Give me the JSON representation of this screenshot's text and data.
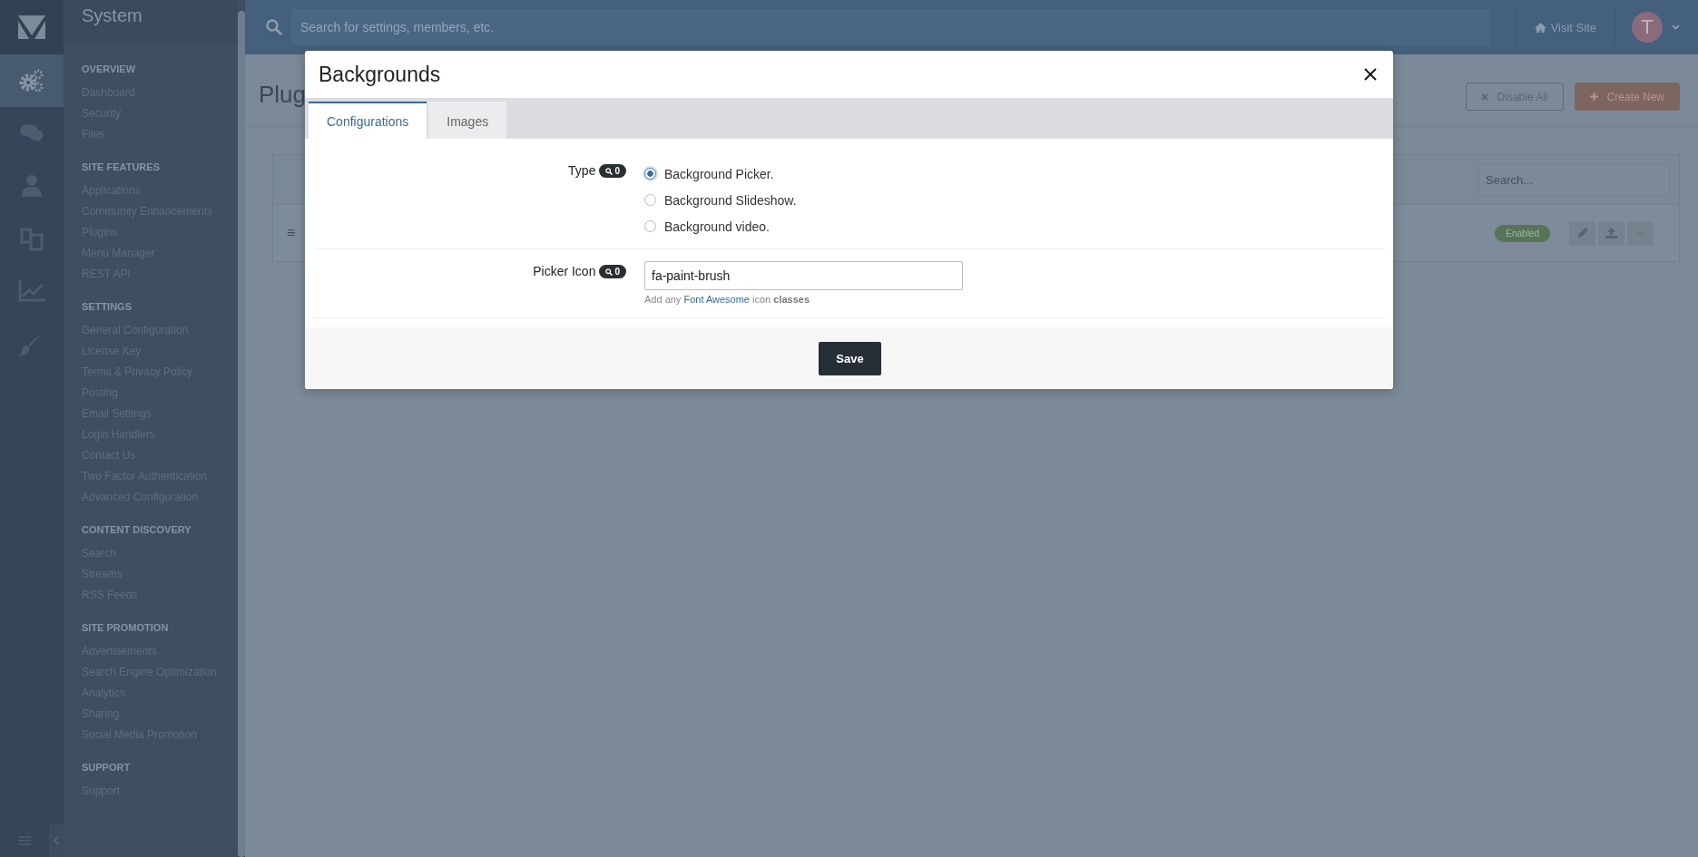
{
  "rail": [
    {
      "selected": true
    },
    {
      "selected": false
    },
    {
      "selected": false
    },
    {
      "selected": false
    },
    {
      "selected": false
    },
    {
      "selected": false
    }
  ],
  "sidebar": {
    "title": "System",
    "sections": [
      {
        "heading": "OVERVIEW",
        "items": [
          "Dashboard",
          "Security",
          "Files"
        ]
      },
      {
        "heading": "SITE FEATURES",
        "items": [
          "Applications",
          "Community Enhancements",
          "Plugins",
          "Menu Manager",
          "REST API"
        ]
      },
      {
        "heading": "SETTINGS",
        "items": [
          "General Configuration",
          "License Key",
          "Terms & Privacy Policy",
          "Posting",
          "Email Settings",
          "Login Handlers",
          "Contact Us",
          "Two Factor Authentication",
          "Advanced Configuration"
        ]
      },
      {
        "heading": "CONTENT DISCOVERY",
        "items": [
          "Search",
          "Streams",
          "RSS Feeds"
        ]
      },
      {
        "heading": "SITE PROMOTION",
        "items": [
          "Advertisements",
          "Search Engine Optimization",
          "Analytics",
          "Sharing",
          "Social Media Promotion"
        ]
      },
      {
        "heading": "SUPPORT",
        "items": [
          "Support"
        ]
      }
    ]
  },
  "top_bar": {
    "search_placeholder": "Search for settings, members, etc.",
    "visit_site": "Visit Site",
    "avatar_letter": "T"
  },
  "page": {
    "title": "Plug",
    "buttons": [
      {
        "label": "Disable All",
        "kind": "outline"
      },
      {
        "label": "Create New",
        "kind": "primary"
      }
    ],
    "table": {
      "search_placeholder": "Search...",
      "rows": [
        {
          "handle": "≡",
          "status": "Enabled"
        }
      ]
    }
  },
  "modal": {
    "title": "Backgrounds",
    "tabs": [
      {
        "label": "Configurations",
        "selected": true
      },
      {
        "label": "Images",
        "selected": false
      }
    ],
    "fields": [
      {
        "label": "Type",
        "count": "0",
        "kind": "radio",
        "options": [
          {
            "label": "Background Picker.",
            "selected": true
          },
          {
            "label": "Background Slideshow.",
            "selected": false
          },
          {
            "label": "Background video.",
            "selected": false
          }
        ]
      },
      {
        "label": "Picker Icon",
        "count": "0",
        "kind": "text",
        "value": "fa-paint-brush",
        "help": {
          "prefix": "Add any",
          "link": "Font Awesome",
          "suffix": "icon **classes**"
        }
      }
    ],
    "save": "Save"
  }
}
